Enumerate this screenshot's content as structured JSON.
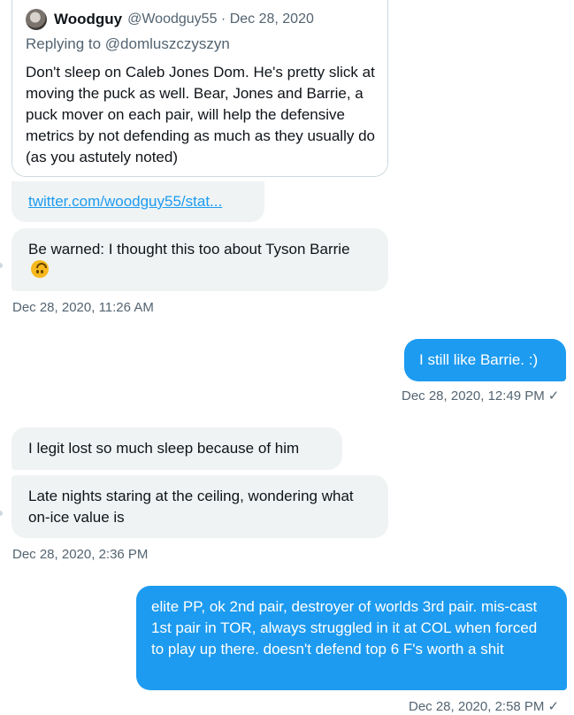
{
  "quoted_tweet": {
    "author_name": "Woodguy",
    "author_handle_date": "@Woodguy55 · Dec 28, 2020",
    "replying_to": "Replying to @domluszczyszyn",
    "text": "Don't sleep on Caleb Jones Dom.  He's pretty slick at moving the puck as well.  Bear, Jones and Barrie, a puck mover on each pair, will help the defensive metrics by not defending as much as they usually do (as you astutely noted)"
  },
  "link": {
    "text": "twitter.com/woodguy55/stat..."
  },
  "messages": [
    {
      "id": "m1",
      "direction": "in",
      "text": "Be warned: I thought this too about Tyson Barrie",
      "emoji": "upside-down-face"
    },
    {
      "id": "m2",
      "direction": "out",
      "text": "I still like Barrie.  :)"
    },
    {
      "id": "m3",
      "direction": "in",
      "text": "I legit lost so much sleep because of him"
    },
    {
      "id": "m4",
      "direction": "in",
      "text": "Late nights staring at the ceiling, wondering what on-ice value is"
    },
    {
      "id": "m5",
      "direction": "out",
      "text": "elite PP, ok 2nd pair, destroyer of worlds 3rd pair. mis-cast 1st pair in TOR, always struggled in it at COL when forced to play up there. doesn't defend top 6 F's worth a shit"
    }
  ],
  "timestamps": {
    "t1": "Dec 28, 2020, 11:26 AM",
    "t2": "Dec 28, 2020, 12:49 PM",
    "t3": "Dec 28, 2020, 2:36 PM",
    "t4": "Dec 28, 2020, 2:58 PM"
  },
  "read_receipt_glyph": "✓",
  "colors": {
    "outgoing": "#1d9bf0",
    "incoming": "#eff3f4",
    "link": "#1d9bf0",
    "muted": "#536471"
  }
}
